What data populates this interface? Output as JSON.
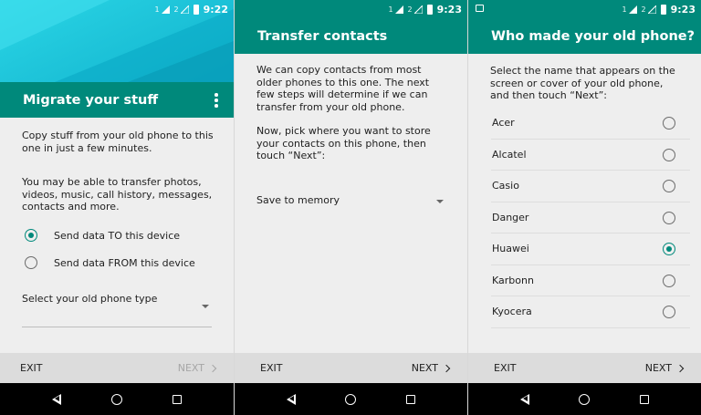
{
  "panels": [
    {
      "status": {
        "sim1": "1",
        "sim2": "2",
        "time": "9:22"
      },
      "title": "Migrate your stuff",
      "intro": "Copy stuff from your old phone to this one in just a few minutes.",
      "body": "You may be able to transfer photos, videos, music, call history, messages, contacts and more.",
      "options": [
        {
          "label": "Send data TO this device",
          "selected": true
        },
        {
          "label": "Send data FROM this device",
          "selected": false
        }
      ],
      "dropdown_placeholder": "Select your old phone type",
      "exit_label": "EXIT",
      "next_label": "NEXT"
    },
    {
      "status": {
        "sim1": "1",
        "sim2": "2",
        "time": "9:23"
      },
      "title": "Transfer contacts",
      "intro": "We can copy contacts from most older phones to this one. The next few steps will determine if we can transfer from your old phone.",
      "body": "Now, pick where you want to store your contacts on this phone, then touch “Next”:",
      "dropdown_value": "Save to memory",
      "exit_label": "EXIT",
      "next_label": "NEXT"
    },
    {
      "status": {
        "sim1": "1",
        "sim2": "2",
        "time": "9:23"
      },
      "title": "Who made your old phone?",
      "intro": "Select the name that appears on the screen or cover of your old phone, and then touch “Next”:",
      "brands": [
        {
          "name": "Acer",
          "selected": false
        },
        {
          "name": "Alcatel",
          "selected": false
        },
        {
          "name": "Casio",
          "selected": false
        },
        {
          "name": "Danger",
          "selected": false
        },
        {
          "name": "Huawei",
          "selected": true
        },
        {
          "name": "Karbonn",
          "selected": false
        },
        {
          "name": "Kyocera",
          "selected": false
        }
      ],
      "exit_label": "EXIT",
      "next_label": "NEXT"
    }
  ],
  "colors": {
    "teal": "#00897b",
    "hero": "#1fc5da",
    "background": "#eeeeee",
    "bottombar": "#dcdcdc"
  },
  "icons": {
    "overflow": "more-vert-icon",
    "next": "chevron-right-icon",
    "dropdown": "arrow-drop-down-icon",
    "nav_back": "back-icon",
    "nav_home": "home-icon",
    "nav_recent": "recents-icon"
  }
}
